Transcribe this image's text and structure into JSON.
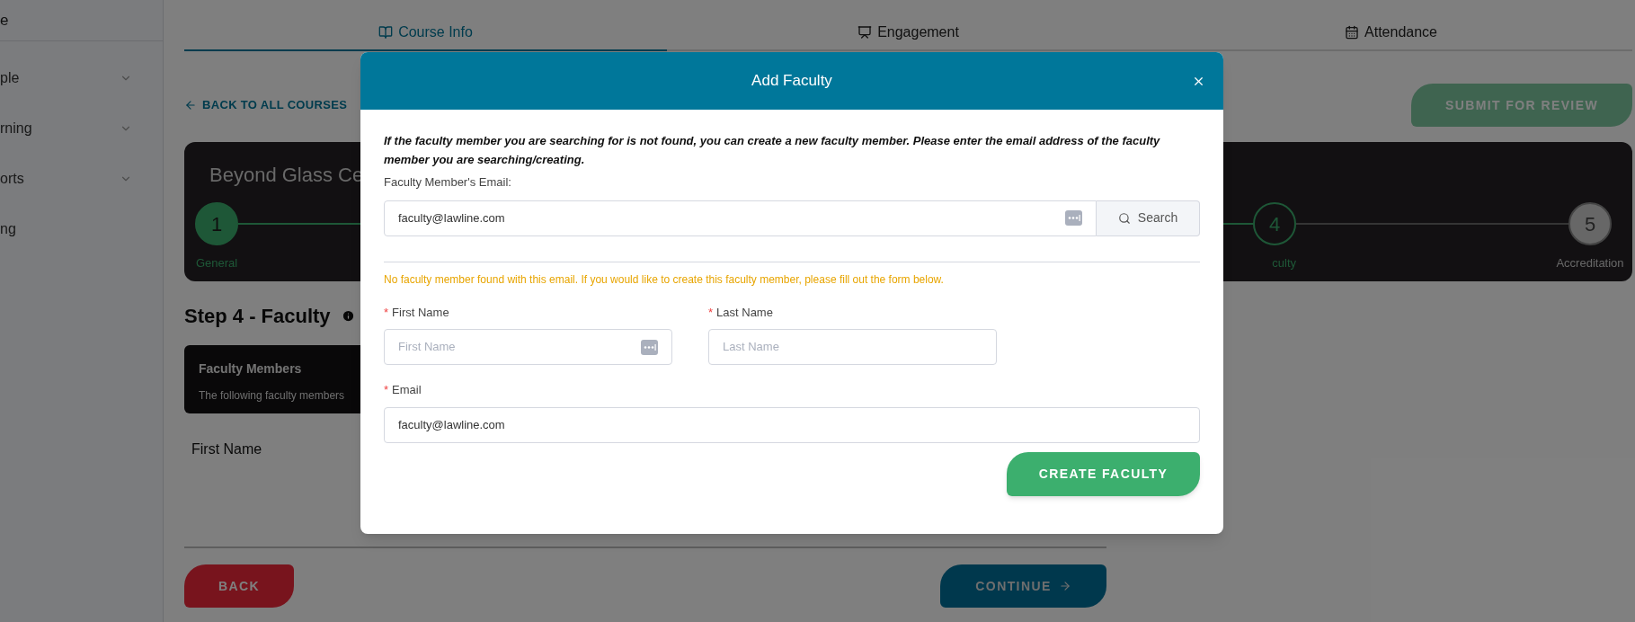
{
  "sidebar": {
    "header": "e",
    "items": [
      {
        "label": "ple",
        "expandable": true
      },
      {
        "label": "rning",
        "expandable": true
      },
      {
        "label": "orts",
        "expandable": true
      },
      {
        "label": "ng",
        "expandable": false
      }
    ]
  },
  "tabs": [
    {
      "label": "Course Info",
      "selected": true
    },
    {
      "label": "Engagement",
      "selected": false
    },
    {
      "label": "Attendance",
      "selected": false
    }
  ],
  "back_link": "BACK TO ALL COURSES",
  "submit_button": {
    "label": "SUBMIT FOR REVIEW",
    "disabled": true
  },
  "course_card": {
    "title": "Beyond Glass Ce",
    "steps": [
      {
        "number": "1",
        "label": "General",
        "kind": "done"
      },
      {
        "number": "4",
        "label": "culty",
        "kind": "current"
      },
      {
        "number": "5",
        "label": "Accreditation",
        "kind": "pending"
      }
    ]
  },
  "step_heading": "Step 4 - Faculty",
  "faculty_card": {
    "title": "Faculty Members",
    "text": "The following faculty members"
  },
  "table_header": "First Name",
  "footer": {
    "back": "BACK",
    "continue": "CONTINUE"
  },
  "modal": {
    "title": "Add Faculty",
    "intro": "If the faculty member you are searching for is not found, you can create a new faculty member. Please enter the email address of the faculty member you are searching/creating.",
    "email_label": "Faculty Member's Email:",
    "email_value": "faculty@lawline.com",
    "search_button": "Search",
    "warning": "No faculty member found with this email. If you would like to create this faculty member, please fill out the form below.",
    "fields": [
      {
        "required_mark": "*",
        "label": "First Name",
        "placeholder": "First Name"
      },
      {
        "required_mark": "*",
        "label": "Last Name",
        "placeholder": "Last Name"
      }
    ],
    "email_field": {
      "required_mark": "*",
      "label": "Email",
      "value": "faculty@lawline.com"
    },
    "create_button": "CREATE FACULTY"
  }
}
